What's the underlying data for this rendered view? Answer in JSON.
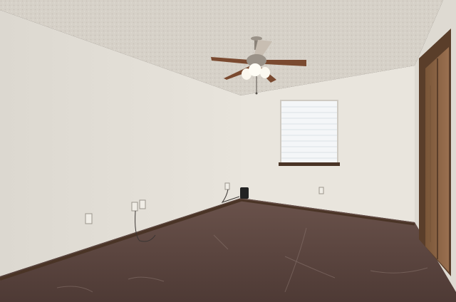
{
  "scene": {
    "kind": "photo",
    "subject": "empty-room-interior",
    "objects": [
      "textured-ceiling",
      "ceiling-fan-with-light",
      "window-with-blinds",
      "closet-door",
      "wall-outlets",
      "small-speaker",
      "concrete-floor",
      "baseboard-trim"
    ]
  },
  "colors": {
    "ceiling": "#d9d4cc",
    "left_wall": "#e4e0d8",
    "back_wall": "#e9e5dd",
    "right_wall": "#dedad2",
    "floor": "#5c4640",
    "trim": "#4a3426",
    "door": "#8a6244",
    "fan_blade": "#7a4a30",
    "window_light": "#f4f6f8"
  }
}
